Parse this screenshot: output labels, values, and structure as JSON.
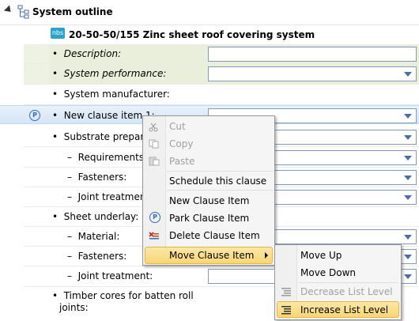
{
  "header": {
    "title": "System outline"
  },
  "clause": {
    "badge": "nbs",
    "title": "20-50-50/155  Zinc sheet roof covering system"
  },
  "rows": [
    {
      "bullet": "•",
      "label": "Description:"
    },
    {
      "bullet": "•",
      "label": "System performance:"
    },
    {
      "bullet": "•",
      "label": "System manufacturer:"
    },
    {
      "bullet": "•",
      "label": "New clause item 1:"
    },
    {
      "bullet": "•",
      "label": "Substrate preparati"
    },
    {
      "bullet": "–",
      "label": "Requirements:"
    },
    {
      "bullet": "–",
      "label": "Fasteners:"
    },
    {
      "bullet": "–",
      "label": "Joint treatment:"
    },
    {
      "bullet": "•",
      "label": "Sheet underlay:"
    },
    {
      "bullet": "–",
      "label": "Material:"
    },
    {
      "bullet": "–",
      "label": "Fasteners:"
    },
    {
      "bullet": "–",
      "label": "Joint treatment:"
    },
    {
      "bullet": "•",
      "label": "Timber cores for batten roll"
    },
    {
      "bullet": "",
      "label": "joints:"
    }
  ],
  "context_menu": {
    "items": [
      {
        "label": "Cut",
        "icon": "scissors-icon",
        "enabled": false
      },
      {
        "label": "Copy",
        "icon": "copy-icon",
        "enabled": false
      },
      {
        "label": "Paste",
        "icon": "paste-icon",
        "enabled": false
      },
      {
        "label": "Schedule this clause",
        "icon": "",
        "enabled": true
      },
      {
        "label": "New Clause Item",
        "icon": "",
        "enabled": true
      },
      {
        "label": "Park Clause Item",
        "icon": "park-icon",
        "enabled": true
      },
      {
        "label": "Delete Clause Item",
        "icon": "delete-item-icon",
        "enabled": true
      },
      {
        "label": "Move Clause Item",
        "icon": "",
        "enabled": true
      }
    ]
  },
  "submenu": {
    "items": [
      {
        "label": "Move Up",
        "enabled": true
      },
      {
        "label": "Move Down",
        "enabled": true
      },
      {
        "label": "Decrease List Level",
        "icon": "decrease-level-icon",
        "enabled": false
      },
      {
        "label": "Increase List Level",
        "icon": "increase-level-icon",
        "enabled": true
      }
    ]
  },
  "colors": {
    "accent_blue": "#2f6db5",
    "highlight": "#f7d675",
    "green_row": "#e9efda"
  }
}
